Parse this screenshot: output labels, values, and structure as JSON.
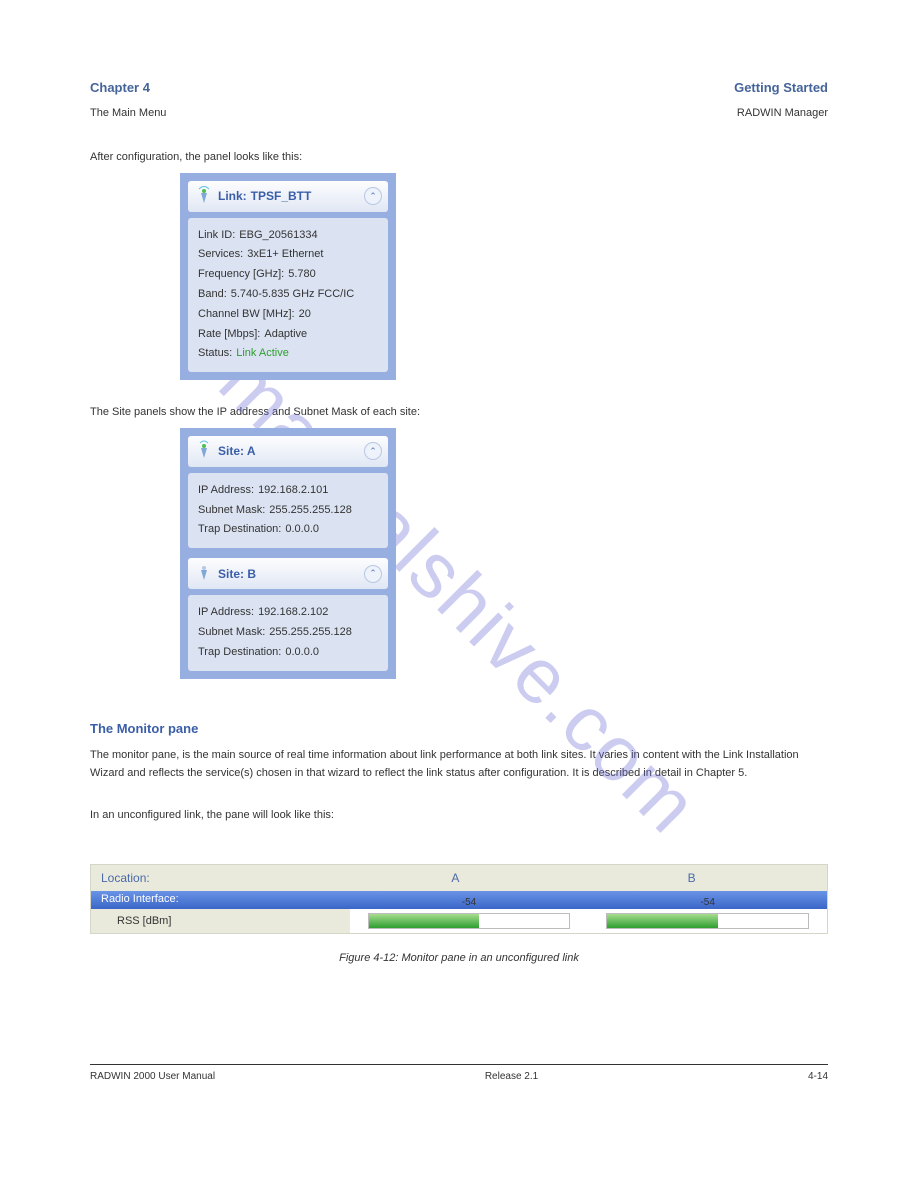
{
  "header": {
    "left": "Chapter 4",
    "right": "Getting Started",
    "sub_left": "The Main Menu",
    "sub_right": "RADWIN Manager"
  },
  "intro_text": "After configuration, the panel looks like this:",
  "link_panel": {
    "title_prefix": "Link:",
    "title_value": "TPSF_BTT",
    "rows": [
      {
        "label": "Link ID:",
        "value": "EBG_20561334"
      },
      {
        "label": "Services:",
        "value": "3xE1+ Ethernet"
      },
      {
        "label": "Frequency [GHz]:",
        "value": "5.780"
      },
      {
        "label": "Band:",
        "value": "5.740-5.835 GHz FCC/IC"
      },
      {
        "label": "Channel BW [MHz]:",
        "value": "20"
      },
      {
        "label": "Rate [Mbps]:",
        "value": "Adaptive"
      }
    ],
    "status_label": "Status:",
    "status_value": "Link Active"
  },
  "site_text": "The Site panels show the IP address and Subnet Mask of each site:",
  "site_a": {
    "title": "Site: A",
    "rows": [
      {
        "label": "IP Address:",
        "value": "192.168.2.101"
      },
      {
        "label": "Subnet Mask:",
        "value": "255.255.255.128"
      },
      {
        "label": "Trap Destination:",
        "value": "0.0.0.0"
      }
    ]
  },
  "site_b": {
    "title": "Site: B",
    "rows": [
      {
        "label": "IP Address:",
        "value": "192.168.2.102"
      },
      {
        "label": "Subnet Mask:",
        "value": "255.255.255.128"
      },
      {
        "label": "Trap Destination:",
        "value": "0.0.0.0"
      }
    ]
  },
  "monitor": {
    "heading": "The Monitor pane",
    "text": "The monitor pane, is the main source of real time information about link performance at both link sites. It varies in content with the Link Installation Wizard and reflects the service(s) chosen in that wizard to reflect the link status after configuration. It is described in detail in Chapter 5.",
    "unconfig_text": "In an unconfigured link, the pane will look like this:"
  },
  "table": {
    "location_label": "Location:",
    "col_a": "A",
    "col_b": "B",
    "section": "Radio Interface:",
    "row_label": "RSS [dBm]",
    "val_a": "-54",
    "val_b": "-54"
  },
  "figure_caption": "Figure 4-12: Monitor pane in an unconfigured link",
  "footer": {
    "left": "RADWIN 2000 User Manual",
    "center": "Release 2.1",
    "right": "4-14"
  },
  "watermark": "manualshive.com"
}
